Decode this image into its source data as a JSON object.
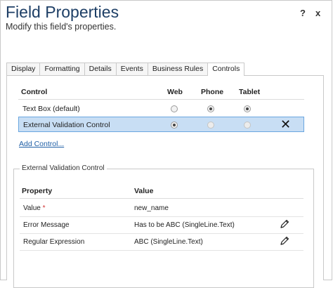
{
  "header": {
    "title": "Field Properties",
    "subtitle": "Modify this field's properties.",
    "help_label": "?",
    "close_label": "x"
  },
  "tabs": [
    {
      "label": "Display",
      "active": false
    },
    {
      "label": "Formatting",
      "active": false
    },
    {
      "label": "Details",
      "active": false
    },
    {
      "label": "Events",
      "active": false
    },
    {
      "label": "Business Rules",
      "active": false
    },
    {
      "label": "Controls",
      "active": true
    }
  ],
  "controls_table": {
    "columns": [
      "Control",
      "Web",
      "Phone",
      "Tablet"
    ],
    "rows": [
      {
        "name": "Text Box (default)",
        "web": false,
        "phone": true,
        "tablet": true,
        "selected": false
      },
      {
        "name": "External Validation Control",
        "web": true,
        "phone": false,
        "tablet": false,
        "selected": true,
        "delete_label": "✕"
      }
    ],
    "add_control_label": "Add Control..."
  },
  "properties_group": {
    "title": "External Validation Control",
    "columns": [
      "Property",
      "Value"
    ],
    "rows": [
      {
        "property": "Value",
        "required_marker": "*",
        "value": "new_name",
        "editable": false
      },
      {
        "property": "Error Message",
        "value": "Has to be ABC (SingleLine.Text)",
        "editable": true
      },
      {
        "property": "Regular Expression",
        "value": "ABC (SingleLine.Text)",
        "editable": true
      }
    ]
  },
  "icons": {
    "edit": "pencil-icon",
    "delete": "x-icon",
    "help": "question-icon",
    "close": "close-icon"
  },
  "colors": {
    "title": "#1e3f66",
    "selected_row_bg": "#c8def4",
    "selected_row_border": "#6aa6e0",
    "link": "#1f5fa6",
    "required": "#d03030"
  }
}
